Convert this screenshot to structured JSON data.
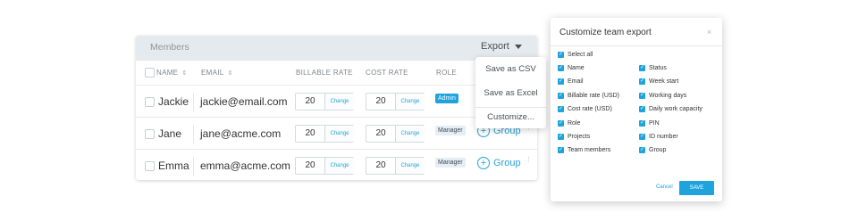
{
  "members_table": {
    "title": "Members",
    "export_label": "Export",
    "columns": {
      "name": "NAME",
      "email": "EMAIL",
      "billable_rate": "BILLABLE RATE",
      "cost_rate": "COST RATE",
      "role": "ROLE"
    },
    "sort_glyph": "⇕",
    "change_label": "Change",
    "group_label": "Group",
    "rows": [
      {
        "name": "Jackie",
        "email": "jackie@email.com",
        "billable": "20",
        "cost": "20",
        "role": "Admin"
      },
      {
        "name": "Jane",
        "email": "jane@acme.com",
        "billable": "20",
        "cost": "20",
        "role": "Manager"
      },
      {
        "name": "Emma",
        "email": "emma@acme.com",
        "billable": "20",
        "cost": "20",
        "role": "Manager"
      }
    ]
  },
  "export_menu": {
    "items": [
      "Save as CSV",
      "Save as Excel",
      "Customize..."
    ]
  },
  "customize_modal": {
    "title": "Customize team export",
    "close_glyph": "×",
    "left_options": [
      "Select all",
      "Name",
      "Email",
      "Billable rate (USD)",
      "Cost rate (USD)",
      "Role",
      "Projects",
      "Team members"
    ],
    "right_options": [
      "Status",
      "Week start",
      "Working days",
      "Daily work capacity",
      "PIN",
      "ID number",
      "Group"
    ],
    "cancel_label": "Cancel",
    "save_label": "SAVE"
  },
  "colors": {
    "accent": "#1fa3dc",
    "header_bg": "#e5eaee"
  }
}
